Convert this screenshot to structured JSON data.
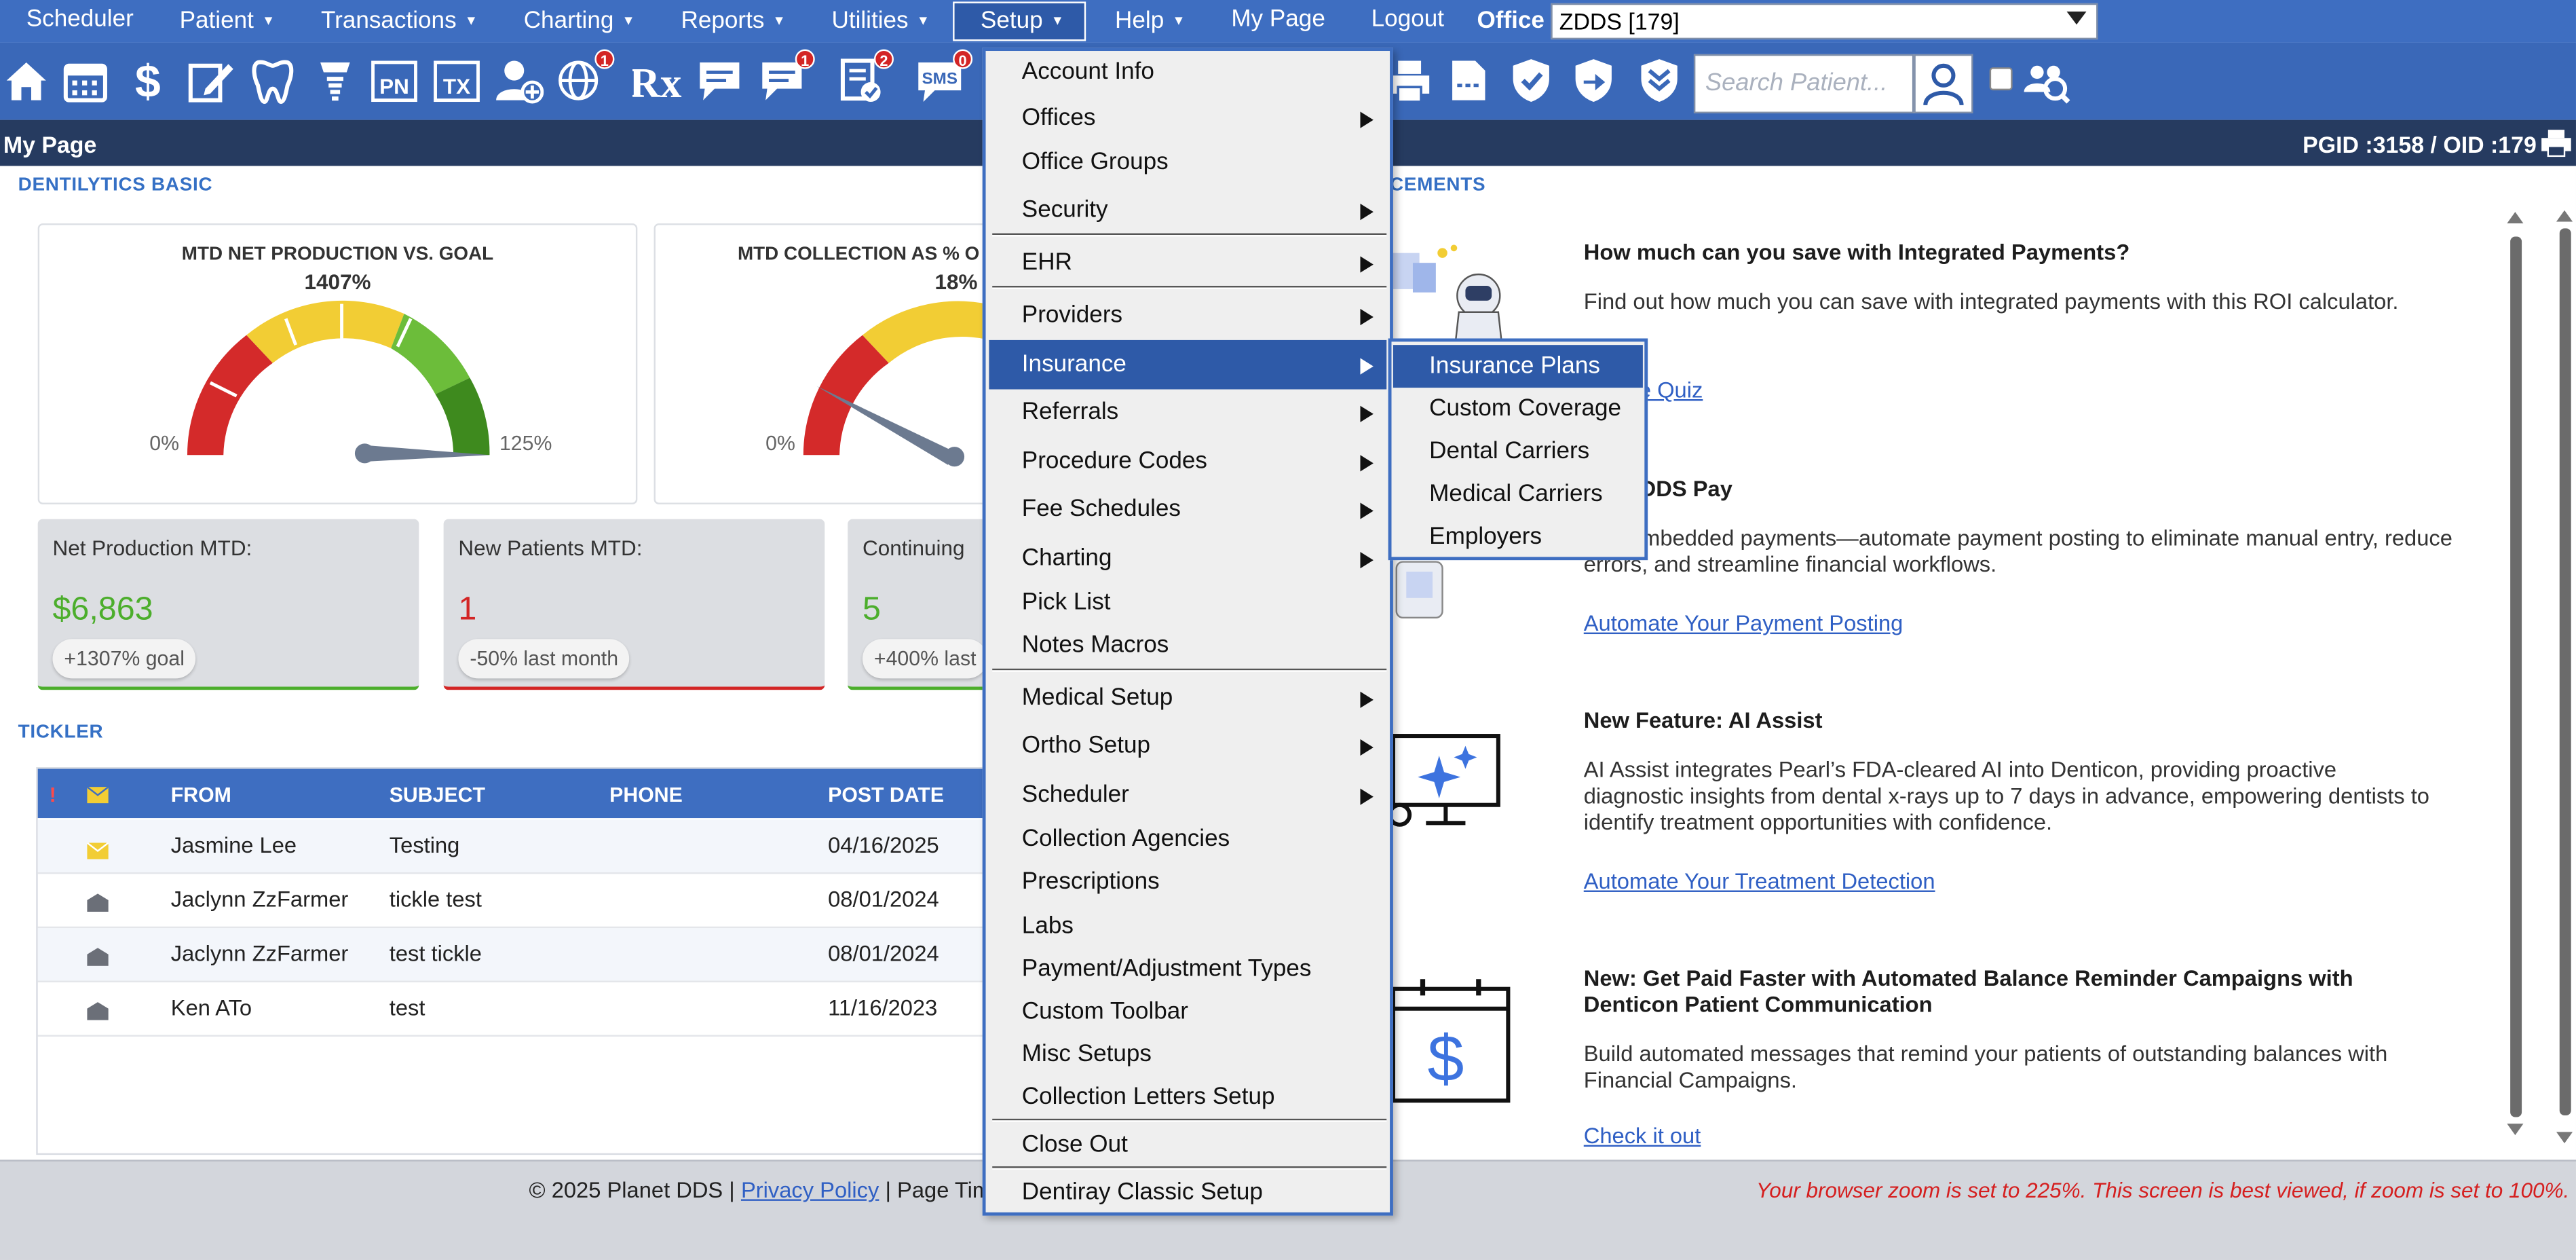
{
  "topnav": {
    "items": [
      {
        "label": "Scheduler",
        "caret": false
      },
      {
        "label": "Patient",
        "caret": true
      },
      {
        "label": "Transactions",
        "caret": true
      },
      {
        "label": "Charting",
        "caret": true
      },
      {
        "label": "Reports",
        "caret": true
      },
      {
        "label": "Utilities",
        "caret": true
      },
      {
        "label": "Setup",
        "caret": true,
        "active": true
      },
      {
        "label": "Help",
        "caret": true
      },
      {
        "label": "My Page",
        "caret": false
      },
      {
        "label": "Logout",
        "caret": false
      }
    ],
    "office_label": "Office",
    "office_value": "ZDDS [179]",
    "caret_glyph": "▼"
  },
  "toolbar": {
    "icons": [
      "home-icon",
      "calendar-icon",
      "dollar-icon",
      "edit-icon",
      "tooth-icon",
      "implant-icon",
      "pn-icon",
      "tx-icon",
      "add-patient-icon",
      "globe-icon",
      "rx-icon",
      "chat-icon",
      "message-icon",
      "document-check-icon",
      "sms-icon"
    ],
    "badges": {
      "globe": "1",
      "message": "1",
      "document": "2",
      "sms": "0"
    },
    "pn_text": "PN",
    "tx_text": "TX",
    "rx_text": "Rx",
    "sms_text": "SMS",
    "search_placeholder": "Search Patient..."
  },
  "pagebar": {
    "title": "My Page",
    "ids": "PGID :3158  /  OID :179"
  },
  "dentilytics": {
    "heading": "DENTILYTICS BASIC",
    "gauges": [
      {
        "title": "MTD NET PRODUCTION VS. GOAL",
        "value": "1407%",
        "min": "0%",
        "max": "125%"
      },
      {
        "title": "MTD COLLECTION AS % O",
        "value": "18%",
        "min": "0%"
      }
    ],
    "stats": [
      {
        "label": "Net Production MTD:",
        "value": "$6,863",
        "pill": "+1307% goal",
        "color": "#4cae2c"
      },
      {
        "label": "New Patients MTD:",
        "value": "1",
        "pill": "-50% last month",
        "color": "#d32525"
      },
      {
        "label": "Continuing",
        "value": "5",
        "pill": "+400% last",
        "color": "#4cae2c"
      }
    ]
  },
  "tickler": {
    "heading": "TICKLER",
    "columns": [
      "!",
      "",
      "FROM",
      "SUBJECT",
      "PHONE",
      "POST DATE"
    ],
    "rows": [
      {
        "from": "Jasmine Lee",
        "subject": "Testing",
        "phone": "",
        "date": "04/16/2025",
        "unread": true
      },
      {
        "from": "Jaclynn ZzFarmer",
        "subject": "tickle test",
        "phone": "",
        "date": "08/01/2024",
        "unread": false
      },
      {
        "from": "Jaclynn ZzFarmer",
        "subject": "test tickle",
        "phone": "",
        "date": "08/01/2024",
        "unread": false
      },
      {
        "from": "Ken ATo",
        "subject": "test",
        "phone": "",
        "date": "11/16/2023",
        "unread": false
      }
    ]
  },
  "announcements": {
    "heading": "CEMENTS",
    "items": [
      {
        "title": "How much can you save with Integrated Payments?",
        "body": "Find out how much you can save with integrated payments with this ROI calculator.",
        "link": "he Quiz"
      },
      {
        "title": "t DDS Pay",
        "body": "less embedded payments—automate payment posting to eliminate manual entry, reduce errors, and streamline financial workflows.",
        "link": "Automate Your Payment Posting"
      },
      {
        "title": "New Feature: AI Assist",
        "body": "AI Assist integrates Pearl’s FDA-cleared AI into Denticon, providing proactive diagnostic insights from dental x-rays up to 7 days in advance, empowering dentists to identify treatment opportunities with confidence.",
        "link": "Automate Your Treatment Detection"
      },
      {
        "title": "New: Get Paid Faster with Automated Balance Reminder Campaigns with Denticon Patient Communication",
        "body": "Build automated messages that remind your patients of outstanding balances with Financial Campaigns.",
        "link": "Check it out"
      }
    ]
  },
  "setup_menu": {
    "items": [
      {
        "label": "Account Info",
        "sub": false
      },
      {
        "label": "Offices",
        "sub": true
      },
      {
        "label": "Office Groups",
        "sub": false
      },
      {
        "label": "Security",
        "sub": true
      },
      {
        "label": "EHR",
        "sub": true
      },
      {
        "label": "Providers",
        "sub": true
      },
      {
        "label": "Insurance",
        "sub": true,
        "active": true
      },
      {
        "label": "Referrals",
        "sub": true
      },
      {
        "label": "Procedure Codes",
        "sub": true
      },
      {
        "label": "Fee Schedules",
        "sub": true
      },
      {
        "label": "Charting",
        "sub": true
      },
      {
        "label": "Pick List",
        "sub": false
      },
      {
        "label": "Notes Macros",
        "sub": false
      },
      {
        "label": "Medical Setup",
        "sub": true
      },
      {
        "label": "Ortho Setup",
        "sub": true
      },
      {
        "label": "Scheduler",
        "sub": true
      },
      {
        "label": "Collection Agencies",
        "sub": false
      },
      {
        "label": "Prescriptions",
        "sub": false
      },
      {
        "label": "Labs",
        "sub": false
      },
      {
        "label": "Payment/Adjustment Types",
        "sub": false
      },
      {
        "label": "Custom Toolbar",
        "sub": false
      },
      {
        "label": "Misc Setups",
        "sub": false
      },
      {
        "label": "Collection Letters Setup",
        "sub": false
      },
      {
        "label": "Close Out",
        "sub": false
      },
      {
        "label": "Dentiray Classic Setup",
        "sub": false
      }
    ]
  },
  "insurance_submenu": {
    "items": [
      "Insurance Plans",
      "Custom Coverage",
      "Dental Carriers",
      "Medical Carriers",
      "Employers"
    ]
  },
  "footer": {
    "copyright": "© 2025 Planet DDS |",
    "privacy": "Privacy Policy",
    "page_time": "|  Page Time",
    "zoom_warning": "Your browser zoom is set to 225%. This screen is best viewed, if zoom is set to 100%."
  },
  "colors": {
    "nav": "#3e6ec1",
    "dark_bar": "#263b60",
    "green": "#4cae2c",
    "red": "#d32525"
  }
}
